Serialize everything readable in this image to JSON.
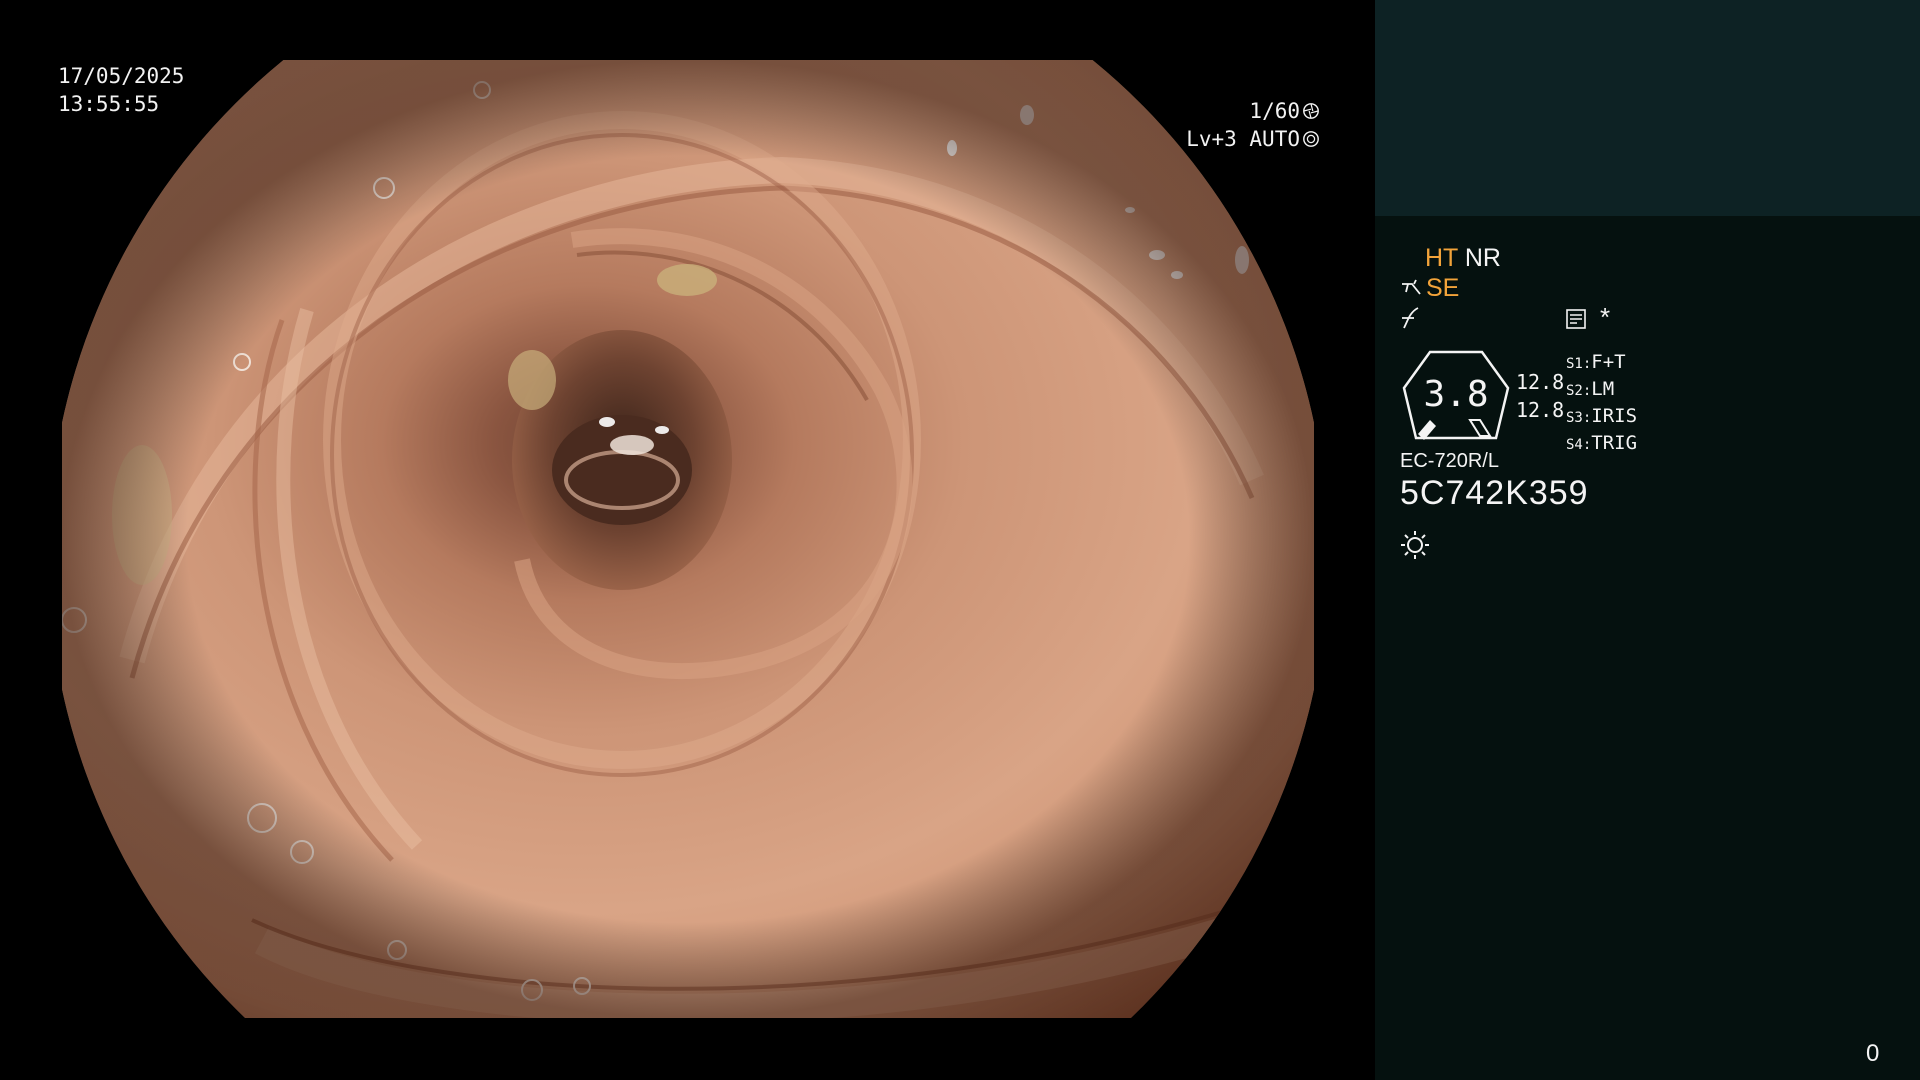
{
  "overlay": {
    "date": "17/05/2025",
    "time": "13:55:55",
    "shutter": "1/60",
    "iris": "Lv+3 AUTO"
  },
  "panel": {
    "mode_ht": "HT",
    "mode_nr": "NR",
    "se": "SE",
    "asterisk": "*",
    "gauge_value": "3.8",
    "value_a": "12.8",
    "value_b": "12.8",
    "switches": [
      {
        "key": "S1:",
        "value": "F+T"
      },
      {
        "key": "S2:",
        "value": "LM"
      },
      {
        "key": "S3:",
        "value": "IRIS"
      },
      {
        "key": "S4:",
        "value": "TRIG"
      }
    ],
    "scope_model": "EC-720R/L",
    "scope_serial": "5C742K359",
    "counter": "0"
  },
  "icons": {
    "shutter": "shutter-icon",
    "iris": "iris-icon",
    "air": "air-water-icon",
    "structure": "structure-enhance-icon",
    "memory": "memory-card-icon",
    "light": "light-source-icon"
  },
  "colors": {
    "accent": "#f2a33a",
    "panel_top": "#0d2224",
    "panel": "#05110f"
  }
}
